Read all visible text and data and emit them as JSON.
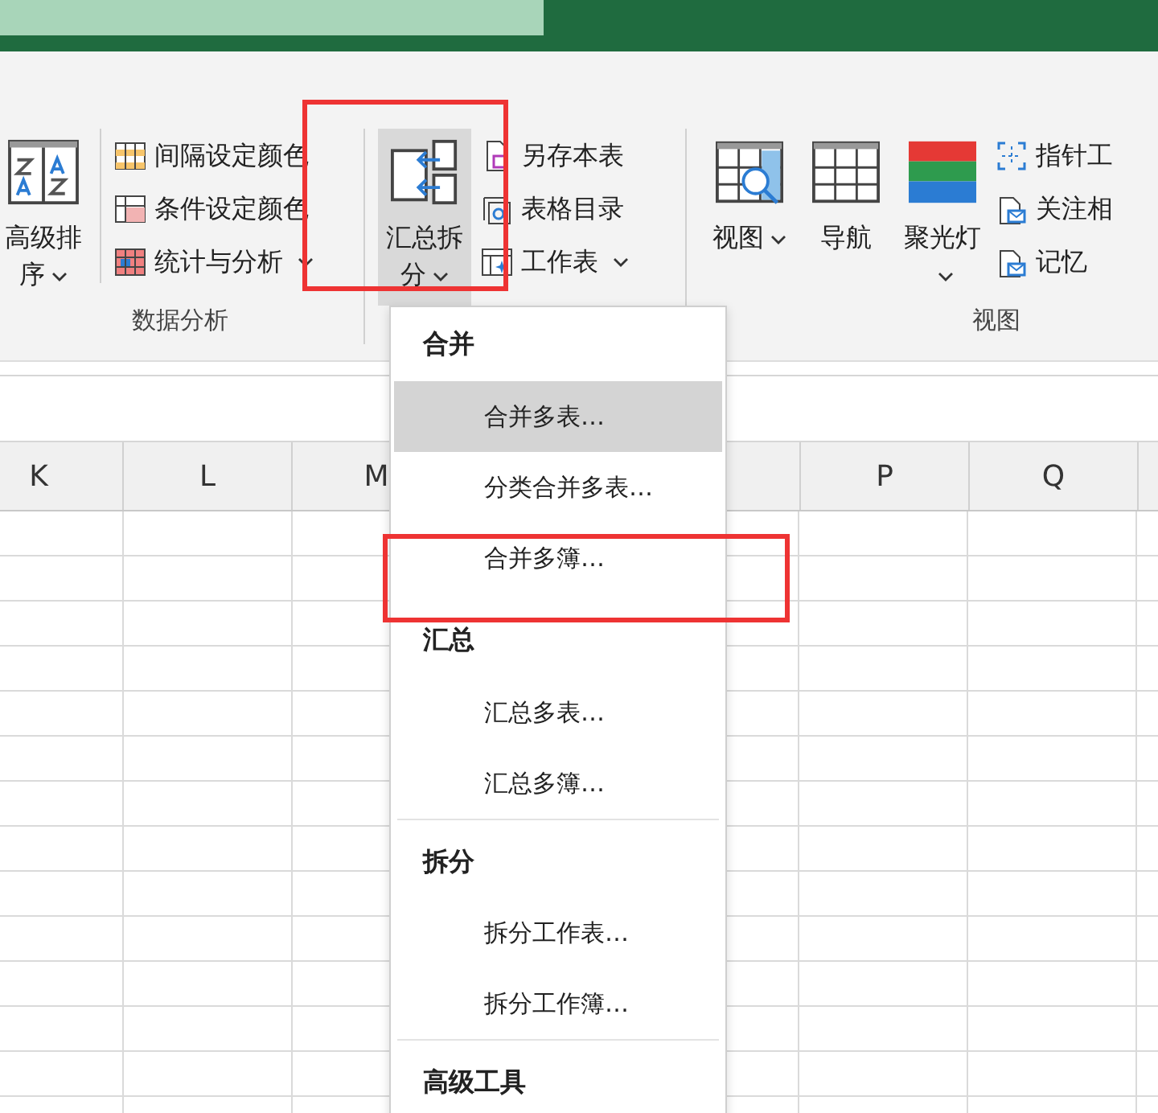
{
  "ribbon": {
    "groups": [
      {
        "label": "数据分析",
        "large_buttons": [
          {
            "label": "高级排序",
            "kind": "sort",
            "dropdown": true,
            "selected": false
          }
        ],
        "small_buttons": [
          {
            "label": "间隔设定颜色",
            "kind": "stripe",
            "dropdown": false
          },
          {
            "label": "条件设定颜色",
            "kind": "condition",
            "dropdown": false
          },
          {
            "label": "统计与分析",
            "kind": "stats",
            "dropdown": true
          }
        ]
      },
      {
        "large_buttons": [
          {
            "label": "汇总拆分",
            "kind": "merge",
            "dropdown": true,
            "selected": true
          }
        ],
        "small_buttons": [
          {
            "label": "另存本表",
            "kind": "save",
            "dropdown": false
          },
          {
            "label": "表格目录",
            "kind": "catalog",
            "dropdown": false
          },
          {
            "label": "工作表",
            "kind": "sheet",
            "dropdown": true
          }
        ]
      },
      {
        "label": "视图",
        "large_buttons": [
          {
            "label": "视图",
            "kind": "view",
            "dropdown": true,
            "selected": false
          },
          {
            "label": "导航",
            "kind": "nav",
            "dropdown": false,
            "selected": false
          },
          {
            "label": "聚光灯",
            "kind": "spotlight",
            "dropdown": true,
            "selected": false
          }
        ],
        "small_buttons": [
          {
            "label": "指针工",
            "kind": "pointer",
            "dropdown": false
          },
          {
            "label": "关注相",
            "kind": "focus",
            "dropdown": false
          },
          {
            "label": "记忆",
            "kind": "focus",
            "dropdown": false
          }
        ]
      }
    ]
  },
  "sheet": {
    "columns": [
      "K",
      "L",
      "M",
      "P",
      "Q"
    ]
  },
  "menu": {
    "sections": [
      {
        "title": "合并",
        "items": [
          {
            "label": "合并多表…",
            "selected": true
          },
          {
            "label": "分类合并多表…",
            "selected": false
          },
          {
            "label": "合并多簿…",
            "selected": false
          }
        ]
      },
      {
        "title": "汇总",
        "items": [
          {
            "label": "汇总多表…",
            "selected": false
          },
          {
            "label": "汇总多簿…",
            "selected": false
          }
        ]
      },
      {
        "title": "拆分",
        "items": [
          {
            "label": "拆分工作表…",
            "selected": false
          },
          {
            "label": "拆分工作簿…",
            "selected": false
          }
        ]
      },
      {
        "title": "高级工具"
      }
    ]
  }
}
